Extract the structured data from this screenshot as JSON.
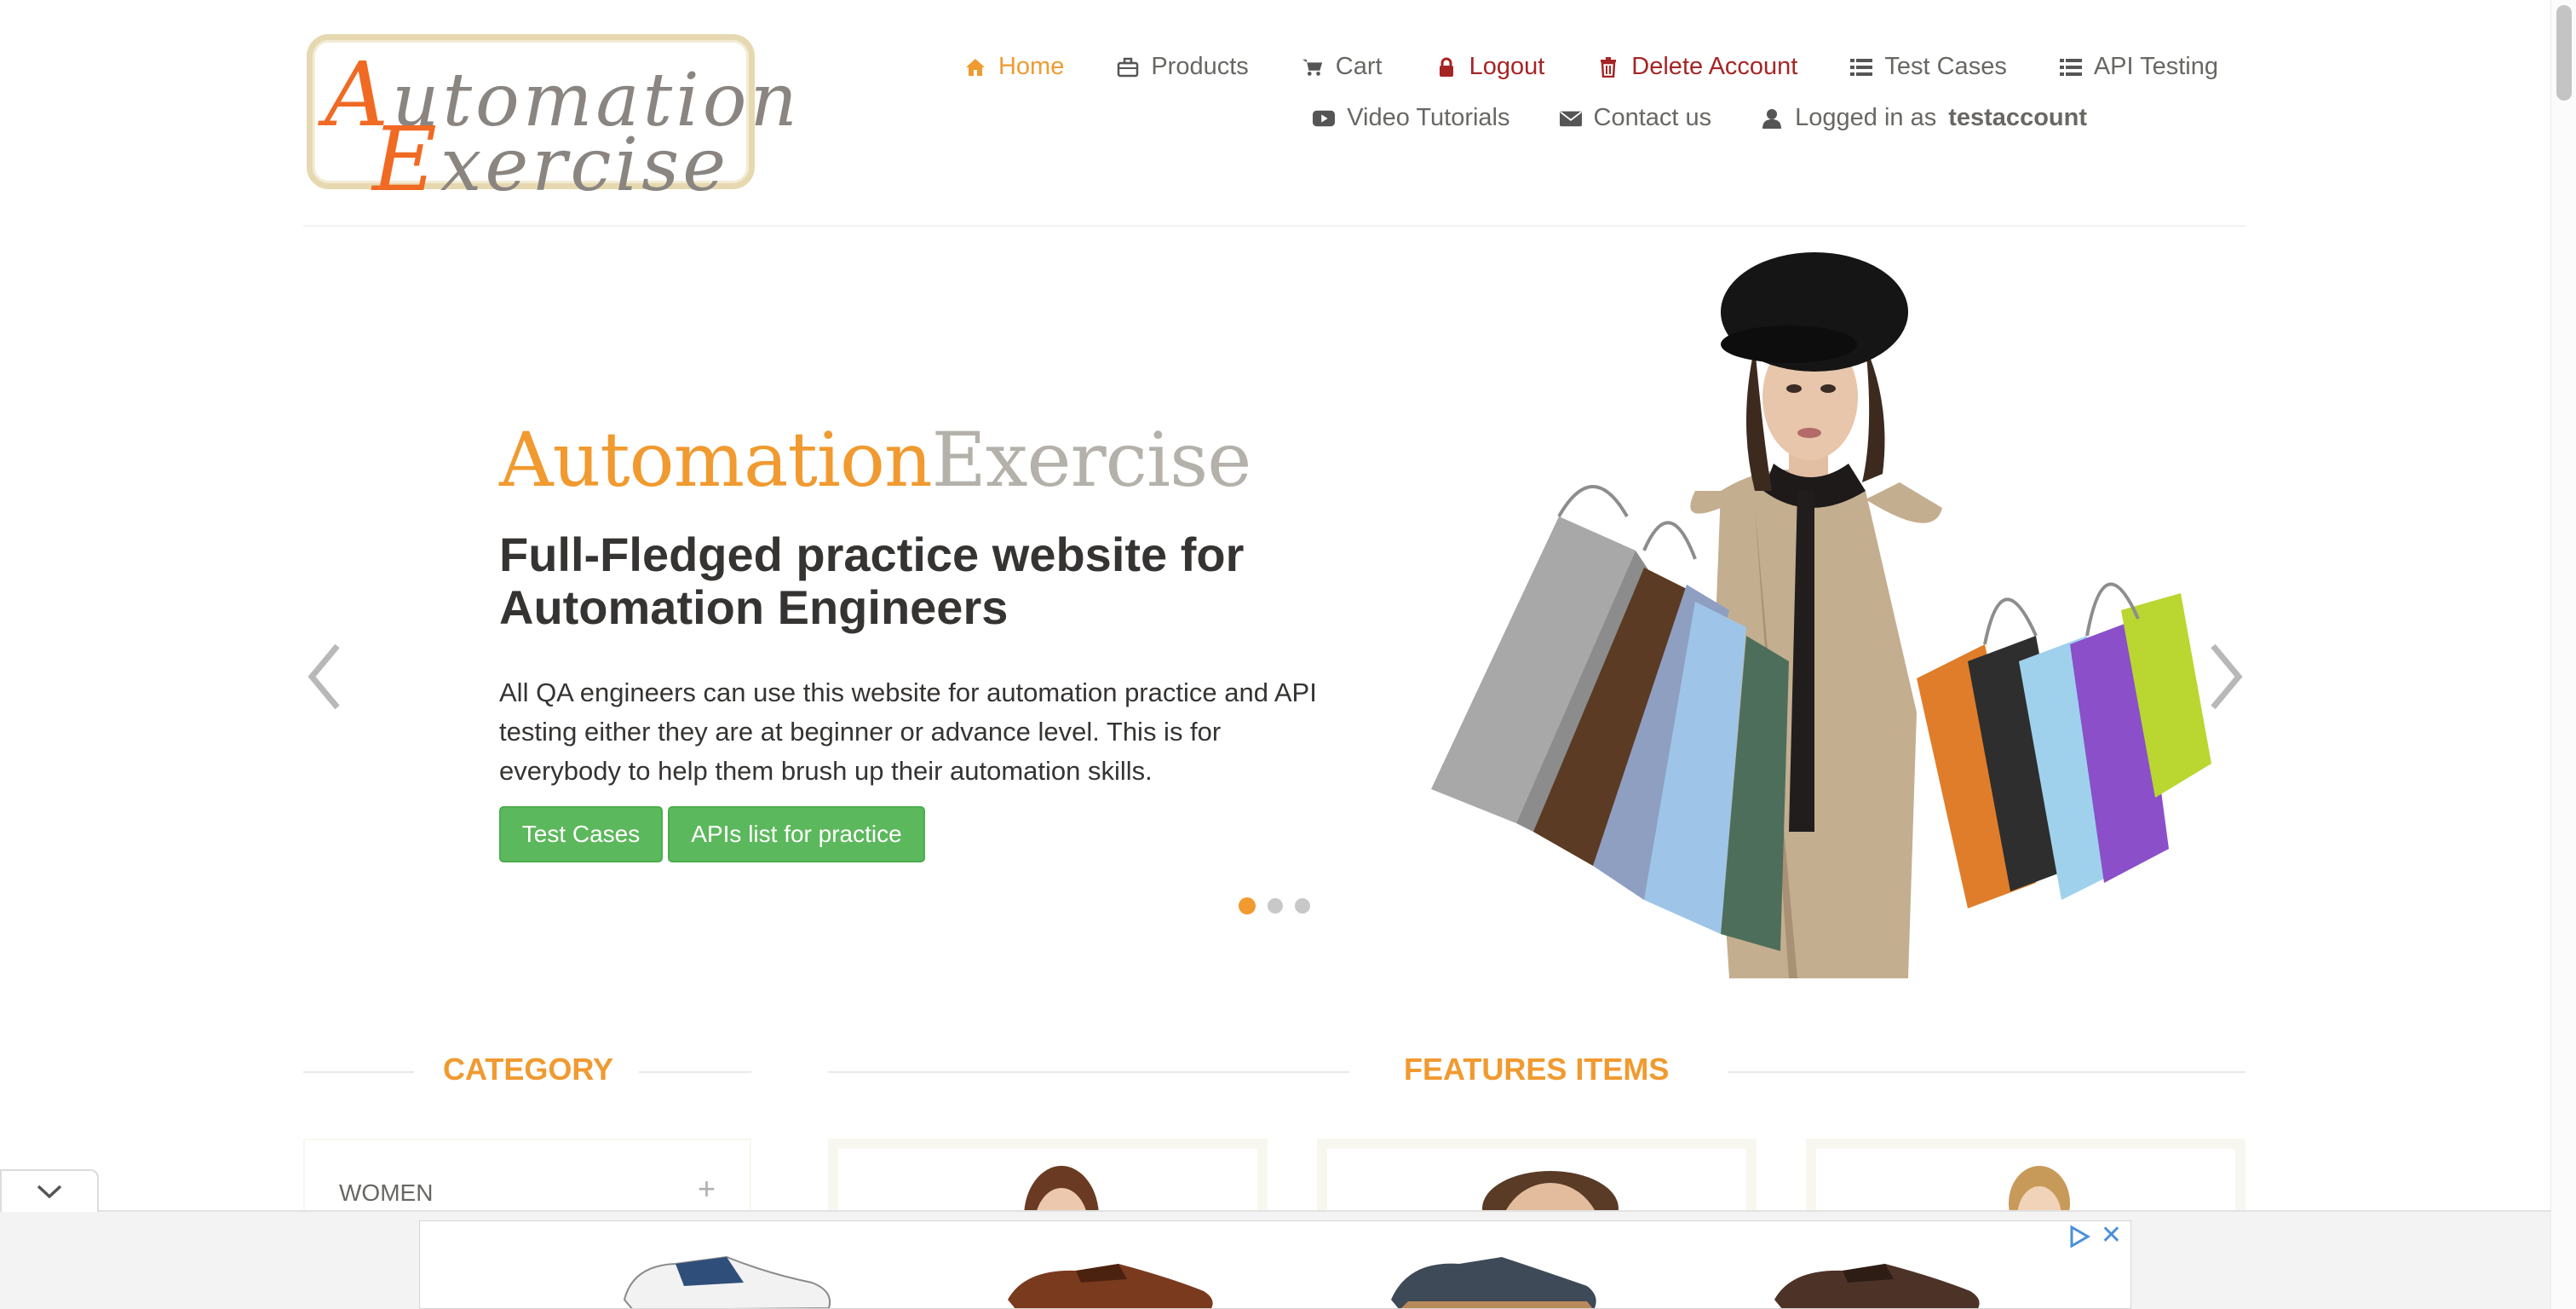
{
  "logo": {
    "line1_cap": "A",
    "line1_rest": "utomation",
    "line2_cap": "E",
    "line2_rest": "xercise"
  },
  "nav": {
    "home": "Home",
    "products": "Products",
    "cart": "Cart",
    "logout": "Logout",
    "delete_account": "Delete Account",
    "test_cases": "Test Cases",
    "api_testing": "API Testing",
    "video_tutorials": "Video Tutorials",
    "contact_us": "Contact us",
    "logged_in_prefix": "Logged in as",
    "username": "testaccount"
  },
  "slider": {
    "brand_a": "Automation",
    "brand_b": "Exercise",
    "headline": "Full-Fledged practice website for Automation Engineers",
    "description": "All QA engineers can use this website for automation practice and API testing either they are at beginner or advance level. This is for everybody to help them brush up their automation skills.",
    "btn_test_cases": "Test Cases",
    "btn_apis": "APIs list for practice",
    "active_slide": 1,
    "slide_count": 3
  },
  "category": {
    "title": "CATEGORY",
    "first_item": "WOMEN",
    "toggle": "+"
  },
  "features": {
    "title": "FEATURES ITEMS"
  },
  "ad": {
    "close": "✕"
  },
  "colors": {
    "accent": "#f09a30",
    "danger": "#a52525",
    "button": "#5cb85c",
    "text": "#696763",
    "heading": "#363432"
  },
  "icons": [
    "home-icon",
    "briefcase-icon",
    "cart-icon",
    "lock-icon",
    "trash-icon",
    "list-icon",
    "youtube-icon",
    "envelope-icon",
    "user-icon",
    "chevron-left-icon",
    "chevron-right-icon",
    "chevron-down-icon",
    "adchoices-icon",
    "close-icon"
  ]
}
